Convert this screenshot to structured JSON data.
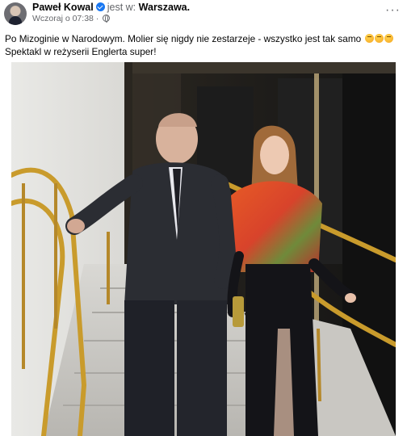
{
  "post": {
    "author": "Paweł Kowal",
    "at_prefix": "jest w:",
    "location": "Warszawa.",
    "timestamp": "Wczoraj o 07:38",
    "separator": "·",
    "privacy_icon": "globe-icon",
    "more_icon": "ellipsis-icon",
    "text_line1": "Po Mizoginie w Narodowym. Molier się nigdy nie zestarzeje - wszystko jest tak samo",
    "text_line2": "Spektakl w reżyserii Englerta super!",
    "emojis": [
      "grimacing-face",
      "grimacing-face",
      "grimacing-face"
    ]
  },
  "photo": {
    "description_hidden": "",
    "colors": {
      "wall": "#d8d8d6",
      "rail": "#c49a2e",
      "scarf_orange": "#e2562a",
      "suit": "#2b2d33"
    }
  }
}
